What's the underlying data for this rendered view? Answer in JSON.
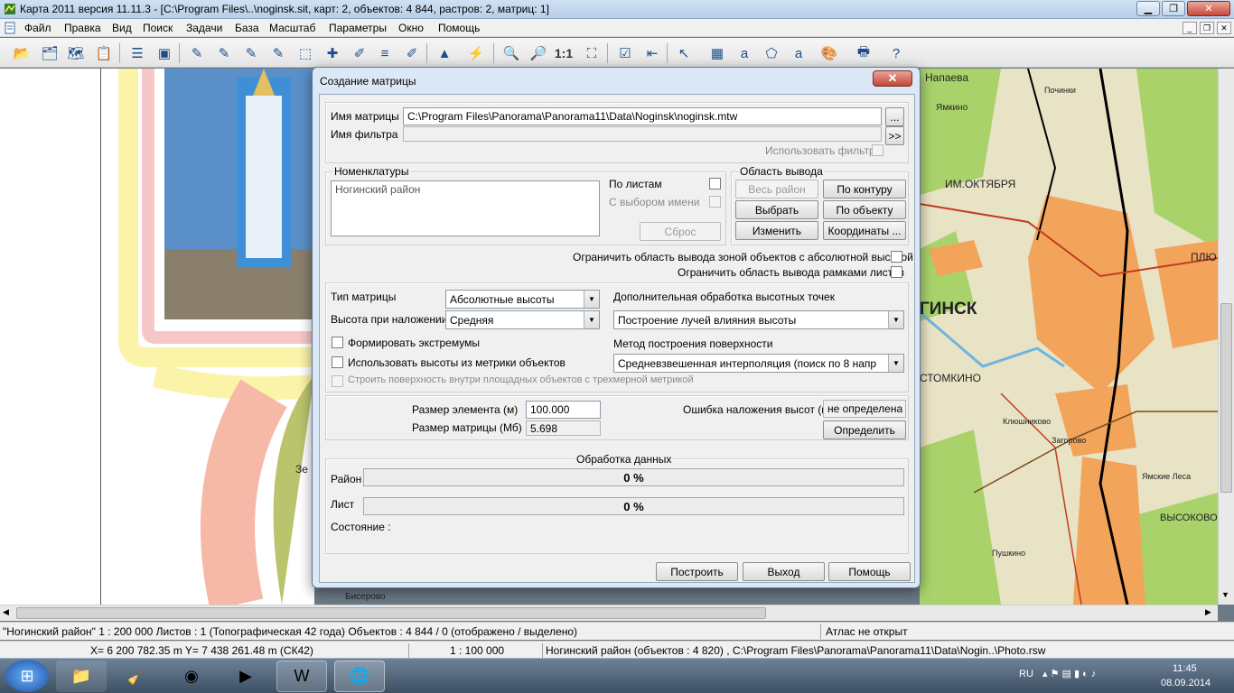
{
  "window": {
    "title": "Карта 2011 версия 11.11.3 - [C:\\Program Files\\..\\noginsk.sit, карт: 2, объектов: 4 844, растров: 2, матриц: 1]"
  },
  "menu": [
    "Файл",
    "Правка",
    "Вид",
    "Поиск",
    "Задачи",
    "База",
    "Масштаб",
    "Параметры",
    "Окно",
    "Помощь"
  ],
  "toolbar": {
    "scale_label": "1:1"
  },
  "map": {
    "labels": {
      "napaeva": "Напаева",
      "yamkino": "Ямкино",
      "pochinki": "Починки",
      "im_oktyabrya": "ИМ.ОКТЯБРЯ",
      "noginsk": "ГИНСК",
      "plyu": "ПЛЮ",
      "stomkino": "СТОМКИНО",
      "klyushnikovo": "Клюшниково",
      "zagorovo": "Загорово",
      "yamskie_lesa": "Ямские Леса",
      "vysokovo": "ВЫСОКОВО",
      "pushkino": "Пушкино",
      "biserovo": "Бисерово",
      "zel": "Зе"
    }
  },
  "dialog": {
    "title": "Создание матрицы",
    "close_label": "✕",
    "matrix_name_label": "Имя матрицы",
    "matrix_name_value": "C:\\Program Files\\Panorama\\Panorama11\\Data\\Noginsk\\noginsk.mtw",
    "browse_label": "...",
    "filter_name_label": "Имя фильтра",
    "filter_button_label": ">>",
    "use_filter_label": "Использовать фильтр",
    "nomenclature": {
      "title": "Номенклатуры",
      "list_item": "Ногинский район",
      "by_sheets": "По листам",
      "with_name_select": "С выбором имени",
      "reset": "Сброс"
    },
    "output_area": {
      "title": "Область вывода",
      "whole_district": "Весь район",
      "by_contour": "По контуру",
      "select": "Выбрать",
      "by_object": "По объекту",
      "change": "Изменить",
      "coordinates": "Координаты ..."
    },
    "limit_abs_height": "Ограничить область вывода зоной объектов с абсолютной высотой",
    "limit_sheet_frames": "Ограничить область вывода рамками листов",
    "matrix_type_label": "Тип матрицы",
    "matrix_type_value": "Абсолютные высоты",
    "overlay_height_label": "Высота при наложении",
    "overlay_height_value": "Средняя",
    "extra_processing_label": "Дополнительная обработка высотных точек",
    "extra_processing_value": "Построение лучей влияния высоты",
    "form_extrema": "Формировать экстремумы",
    "surface_method_label": "Метод построения поверхности",
    "surface_method_value": "Средневзвешенная интерполяция (поиск по  8 напр",
    "use_object_heights": "Использовать высоты из метрики объектов",
    "build_surface_3d": "Строить поверхность внутри площадных объектов с трехмерной метрикой",
    "element_size_label": "Размер элемента (м)",
    "element_size_value": "100.000",
    "matrix_size_label": "Размер матрицы (Мб)",
    "matrix_size_value": "5.698",
    "overlay_error_label": "Ошибка наложения высот (м)",
    "overlay_error_value": "не определена",
    "determine_label": "Определить",
    "processing_title": "Обработка данных",
    "district_label": "Район",
    "district_progress": "0 %",
    "sheet_label": "Лист",
    "sheet_progress": "0 %",
    "state_label": "Состояние :",
    "build_label": "Построить",
    "exit_label": "Выход",
    "help_label": "Помощь"
  },
  "status": {
    "district_info": "\"Ногинский район\"  1 : 200 000   Листов : 1   (Топографическая 42 года)  Объектов : 4 844 / 0 (отображено / выделено)",
    "atlas": "Атлас не открыт",
    "coords": "X= 6 200 782.35 m     Y= 7 438 261.48 m   (СК42)",
    "scale": "1 : 100 000",
    "raster": "Ногинский район   (объектов : 4 820) , C:\\Program Files\\Panorama\\Panorama11\\Data\\Nogin..\\Photo.rsw"
  },
  "tray": {
    "lang": "RU",
    "time": "11:45",
    "date": "08.09.2014"
  }
}
